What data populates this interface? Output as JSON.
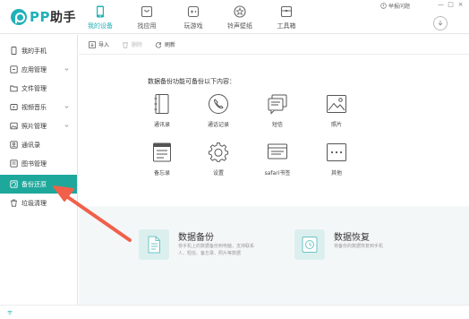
{
  "app": {
    "logo_text": "PP",
    "logo_cn": "助手",
    "feedback": "举报问题"
  },
  "nav": [
    {
      "label": "我的设备",
      "icon": "phone-icon",
      "active": true
    },
    {
      "label": "找应用",
      "icon": "bag-icon",
      "active": false
    },
    {
      "label": "玩游戏",
      "icon": "gamepad-icon",
      "active": false
    },
    {
      "label": "铃声壁纸",
      "icon": "star-icon",
      "active": false
    },
    {
      "label": "工具箱",
      "icon": "toolbox-icon",
      "active": false
    }
  ],
  "window_controls": [
    "—",
    "□",
    "×"
  ],
  "sidebar": {
    "items": [
      {
        "label": "我的手机",
        "icon": "phone-icon"
      },
      {
        "label": "应用管理",
        "icon": "app-icon",
        "expandable": true
      },
      {
        "label": "文件管理",
        "icon": "folder-icon"
      },
      {
        "label": "视频音乐",
        "icon": "video-icon",
        "expandable": true
      },
      {
        "label": "照片管理",
        "icon": "photo-icon",
        "expandable": true
      },
      {
        "label": "通讯录",
        "icon": "contacts-icon"
      },
      {
        "label": "图书管理",
        "icon": "book-icon"
      },
      {
        "label": "备份还原",
        "icon": "backup-icon",
        "active": true
      },
      {
        "label": "垃圾清理",
        "icon": "trash-icon"
      }
    ]
  },
  "toolbar": {
    "import_label": "导入",
    "delete_label": "删除",
    "refresh_label": "刷新"
  },
  "backup": {
    "intro": "数据备份功能可备份以下内容：",
    "categories": [
      {
        "label": "通讯录",
        "icon": "contacts-book-icon"
      },
      {
        "label": "通话记录",
        "icon": "call-log-icon"
      },
      {
        "label": "短信",
        "icon": "sms-icon"
      },
      {
        "label": "照片",
        "icon": "photos-icon"
      },
      {
        "label": "备忘录",
        "icon": "memo-icon"
      },
      {
        "label": "设置",
        "icon": "settings-icon"
      },
      {
        "label": "safari书签",
        "icon": "bookmark-icon"
      },
      {
        "label": "其他",
        "icon": "other-icon"
      }
    ]
  },
  "features": {
    "backup": {
      "title": "数据备份",
      "desc_line1": "将手机上的数据备份到电脑，支持联系",
      "desc_line2": "人、短信、备忘录、照片等数据"
    },
    "restore": {
      "title": "数据恢复",
      "desc_line1": "将备份的数据恢复到手机"
    }
  },
  "colors": {
    "accent": "#21b0b8",
    "sidebar_active": "#1ea89c",
    "annotation_arrow": "#f0604a"
  }
}
